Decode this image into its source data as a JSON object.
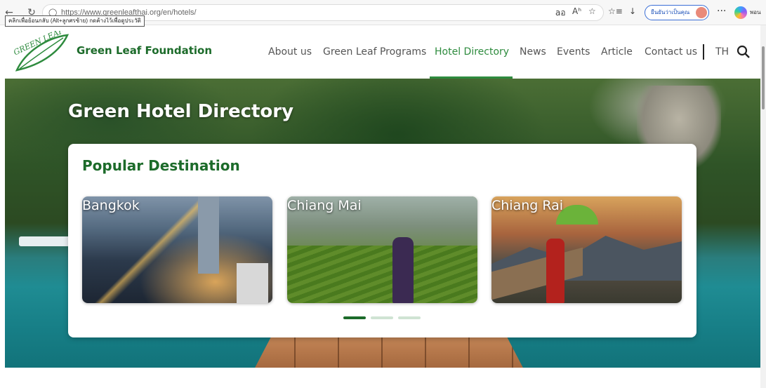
{
  "browser": {
    "url": "https://www.greenleafthai.org/en/hotels/",
    "tooltip": "คลิกเพื่อย้อนกลับ (Alt+ลูกศรซ้าย) กดค้างไว้เพื่อดูประวัติ",
    "profile_label": "ยืนยันว่าเป็นคุณ",
    "side_label": "พอน"
  },
  "header": {
    "brand": "Green Leaf Foundation",
    "logo_text": "GREEN LEAF",
    "nav": [
      {
        "label": "About us",
        "active": false
      },
      {
        "label": "Green Leaf Programs",
        "active": false
      },
      {
        "label": "Hotel Directory",
        "active": true
      },
      {
        "label": "News",
        "active": false
      },
      {
        "label": "Events",
        "active": false
      },
      {
        "label": "Article",
        "active": false
      },
      {
        "label": "Contact us",
        "active": false
      }
    ],
    "lang": "TH"
  },
  "hero": {
    "title": "Green Hotel Directory"
  },
  "destinations": {
    "heading": "Popular Destination",
    "items": [
      {
        "name": "Bangkok"
      },
      {
        "name": "Chiang Mai"
      },
      {
        "name": "Chiang Rai"
      }
    ],
    "slider": {
      "pages": 3,
      "active": 1
    }
  },
  "colors": {
    "brand_green": "#1c6b2a",
    "active_nav": "#2e8b3e"
  }
}
